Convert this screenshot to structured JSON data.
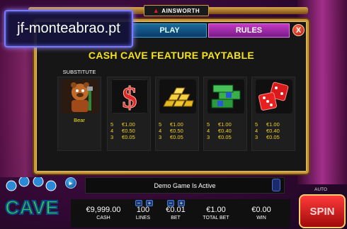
{
  "brand": "AINSWORTH",
  "watermark": "jf-monteabrao.pt",
  "tabs": {
    "play": "PLAY",
    "rules": "RULES",
    "close": "X"
  },
  "panel_title": "CASH CAVE FEATURE PAYTABLE",
  "symbols": [
    {
      "icon": "bear-icon",
      "label_top": "SUBSTITUTE",
      "name": "Bear",
      "pays": []
    },
    {
      "icon": "dollar-sign-icon",
      "pays": [
        {
          "count": "5",
          "value": "€1.00"
        },
        {
          "count": "4",
          "value": "€0.50"
        },
        {
          "count": "3",
          "value": "€0.05"
        }
      ]
    },
    {
      "icon": "gold-bars-icon",
      "pays": [
        {
          "count": "5",
          "value": "€1.00"
        },
        {
          "count": "4",
          "value": "€0.50"
        },
        {
          "count": "3",
          "value": "€0.05"
        }
      ]
    },
    {
      "icon": "cash-stack-icon",
      "pays": [
        {
          "count": "5",
          "value": "€1.00"
        },
        {
          "count": "4",
          "value": "€0.40"
        },
        {
          "count": "3",
          "value": "€0.05"
        }
      ]
    },
    {
      "icon": "dice-icon",
      "pays": [
        {
          "count": "5",
          "value": "€1.00"
        },
        {
          "count": "4",
          "value": "€0.40"
        },
        {
          "count": "3",
          "value": "€0.05"
        }
      ]
    }
  ],
  "status_message": "Demo Game Is Active",
  "hud": {
    "cash": {
      "value": "€9,999.00",
      "label": "CASH"
    },
    "lines": {
      "value": "100",
      "label": "LINES"
    },
    "bet": {
      "value": "€0.01",
      "label": "BET"
    },
    "total_bet": {
      "value": "€1.00",
      "label": "TOTAL BET"
    },
    "win": {
      "value": "€0.00",
      "label": "WIN"
    }
  },
  "logo_text": "CAVE",
  "auto_label": "AUTO",
  "spin_label": "SPIN",
  "colors": {
    "frame_gold": "#c99a3a",
    "title_yellow": "#f6e316",
    "rules_tab": "#c23ac2",
    "play_tab": "#1a6a9a"
  }
}
